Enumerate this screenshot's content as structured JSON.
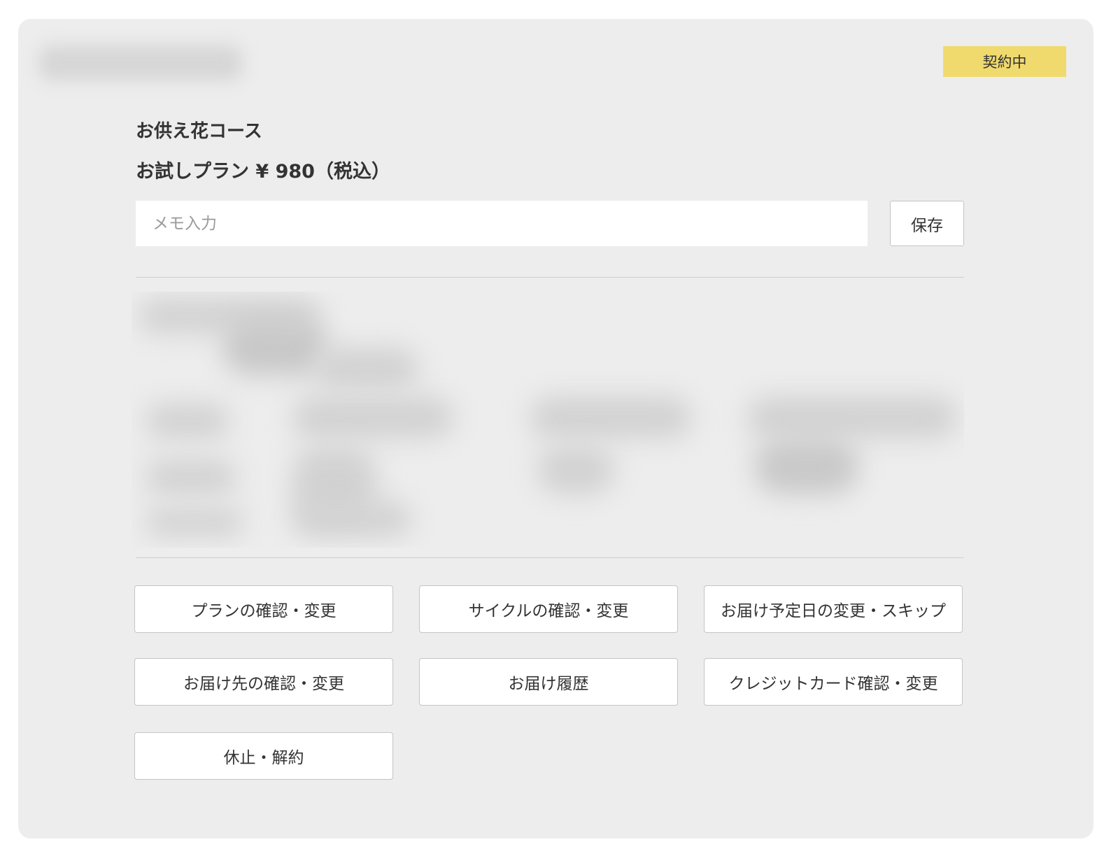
{
  "status_badge": "契約中",
  "course_title": "お供え花コース",
  "plan_line": "お試しプラン ¥ 980（税込）",
  "memo": {
    "placeholder": "メモ入力",
    "value": ""
  },
  "save_label": "保存",
  "actions": [
    "プランの確認・変更",
    "サイクルの確認・変更",
    "お届け予定日の変更・スキップ",
    "お届け先の確認・変更",
    "お届け履歴",
    "クレジットカード確認・変更",
    "休止・解約"
  ],
  "colors": {
    "badge": "#f0da6e",
    "card_bg": "#ededed"
  }
}
